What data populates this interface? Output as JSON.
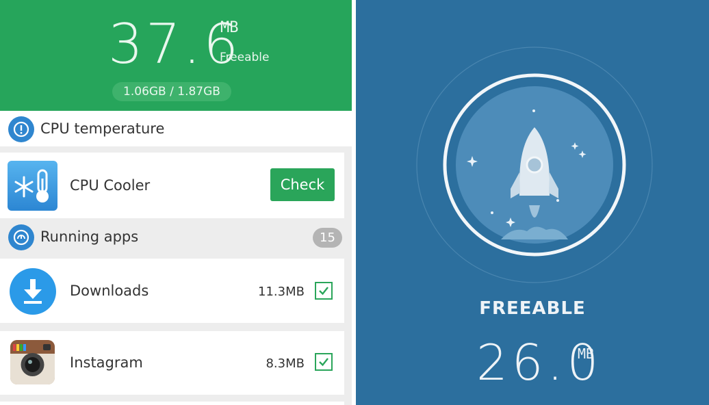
{
  "header": {
    "freeable_value": "37.6",
    "freeable_unit": "MB",
    "freeable_label": "Freeable",
    "memory_usage": "1.06GB / 1.87GB"
  },
  "cpu_section": {
    "title": "CPU temperature",
    "icon": "alert-icon"
  },
  "cpu_cooler": {
    "label": "CPU Cooler",
    "button_label": "Check",
    "icon": "snowflake-thermometer-icon"
  },
  "running_section": {
    "title": "Running apps",
    "count": "15",
    "icon": "speedometer-icon"
  },
  "apps": [
    {
      "name": "Downloads",
      "size": "11.3MB",
      "checked": true,
      "icon": "download-icon"
    },
    {
      "name": "Instagram",
      "size": "8.3MB",
      "checked": true,
      "icon": "instagram-camera-icon"
    }
  ],
  "boost": {
    "title": "FREEABLE",
    "value": "26.0",
    "unit": "MB",
    "icon": "rocket-icon"
  },
  "colors": {
    "green": "#26a55b",
    "blue_panel": "#2c6f9e",
    "accent_blue": "#2f86cf"
  }
}
